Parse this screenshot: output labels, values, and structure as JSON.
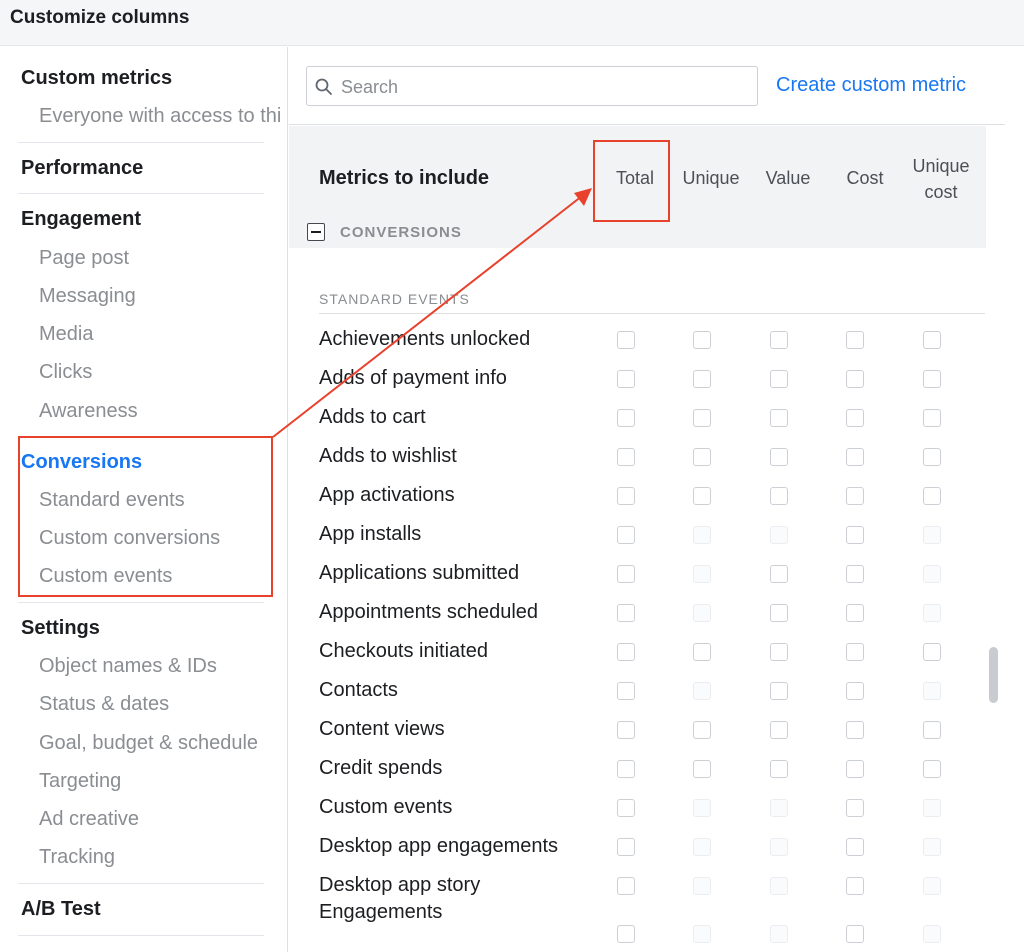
{
  "dialog": {
    "title": "Customize columns"
  },
  "sidebar": {
    "custom_metrics": {
      "title": "Custom metrics",
      "description": "Everyone with access to thi"
    },
    "performance": {
      "title": "Performance"
    },
    "engagement": {
      "title": "Engagement",
      "items": [
        "Page post",
        "Messaging",
        "Media",
        "Clicks",
        "Awareness"
      ]
    },
    "conversions": {
      "title": "Conversions",
      "items": [
        "Standard events",
        "Custom conversions",
        "Custom events"
      ]
    },
    "settings": {
      "title": "Settings",
      "items": [
        "Object names & IDs",
        "Status & dates",
        "Goal, budget & schedule",
        "Targeting",
        "Ad creative",
        "Tracking"
      ]
    },
    "ab_test": {
      "title": "A/B Test"
    }
  },
  "search": {
    "placeholder": "Search",
    "value": ""
  },
  "create_link": "Create custom metric",
  "metrics_header": {
    "title": "Metrics to include",
    "columns": [
      "Total",
      "Unique",
      "Value",
      "Cost",
      "Unique cost"
    ]
  },
  "section": {
    "label": "CONVERSIONS",
    "subheading": "STANDARD EVENTS"
  },
  "rows": [
    {
      "label": "Achievements unlocked",
      "enabled": [
        true,
        true,
        true,
        true,
        true
      ]
    },
    {
      "label": "Adds of payment info",
      "enabled": [
        true,
        true,
        true,
        true,
        true
      ]
    },
    {
      "label": "Adds to cart",
      "enabled": [
        true,
        true,
        true,
        true,
        true
      ]
    },
    {
      "label": "Adds to wishlist",
      "enabled": [
        true,
        true,
        true,
        true,
        true
      ]
    },
    {
      "label": "App activations",
      "enabled": [
        true,
        true,
        true,
        true,
        true
      ]
    },
    {
      "label": "App installs",
      "enabled": [
        true,
        false,
        false,
        true,
        false
      ]
    },
    {
      "label": "Applications submitted",
      "enabled": [
        true,
        false,
        true,
        true,
        false
      ]
    },
    {
      "label": "Appointments scheduled",
      "enabled": [
        true,
        false,
        true,
        true,
        false
      ]
    },
    {
      "label": "Checkouts initiated",
      "enabled": [
        true,
        true,
        true,
        true,
        true
      ]
    },
    {
      "label": "Contacts",
      "enabled": [
        true,
        false,
        true,
        true,
        false
      ]
    },
    {
      "label": "Content views",
      "enabled": [
        true,
        true,
        true,
        true,
        true
      ]
    },
    {
      "label": "Credit spends",
      "enabled": [
        true,
        true,
        true,
        true,
        true
      ]
    },
    {
      "label": "Custom events",
      "enabled": [
        true,
        false,
        false,
        true,
        false
      ]
    },
    {
      "label": "Desktop app engagements",
      "enabled": [
        true,
        false,
        false,
        true,
        false
      ]
    },
    {
      "label": "Desktop app story\nEngagements",
      "enabled": [
        true,
        false,
        false,
        true,
        false
      ]
    }
  ],
  "colors": {
    "accent": "#1877f2",
    "annotation": "#e8412c",
    "muted": "#8a8d91",
    "header_bg": "#f2f3f5"
  },
  "icons": {
    "search": "search-icon",
    "collapse": "minus-square-icon"
  }
}
